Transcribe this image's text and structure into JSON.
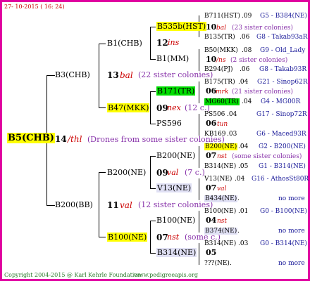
{
  "header": {
    "date": "27- 10-2015 ( 16: 24)"
  },
  "footer": {
    "copyright": "Copyright 2004-2015 @ Karl Kehrle Foundation.",
    "site": "www.pedigreeapis.org"
  },
  "root": {
    "name": "B5(CHB)",
    "num": "14",
    "ins": "/thl",
    "note": "(Drones from some sister colonies)"
  },
  "gen1": {
    "upper": {
      "name": "B3(CHB)",
      "num": "13",
      "ins": "bal",
      "note": "(22 sister colonies)"
    },
    "lower": {
      "name": "B200(BB)",
      "num": "11",
      "ins": "val",
      "note": "(12 sister colonies)"
    }
  },
  "gen2": {
    "b1chb": {
      "name": "B1(CHB)"
    },
    "b47": {
      "name": "B47(MKK)",
      "num": "09",
      "ins": "nex",
      "note": "(12 c.)"
    },
    "b200ne": {
      "name": "B200(NE)",
      "num": "09",
      "ins": "val",
      "note": "(7 c.)"
    },
    "b100ne": {
      "name": "B100(NE)",
      "num": "07",
      "ins": "nst",
      "note": "(some c.)"
    }
  },
  "gen3": {
    "b535b": {
      "name": "B535b(HST)",
      "num": "12",
      "ins": "ins"
    },
    "b1mm": {
      "name": "B1(MM)"
    },
    "b171": {
      "name": "B171(TR)",
      "num": "06",
      "ins": "mrk",
      "note": "(21 sister colonies)"
    },
    "ps596": {
      "name": "PS596",
      "num": "06",
      "ins": "tun"
    },
    "b200ne2": {
      "name": "B200(NE)",
      "num": "07",
      "ins": "nst",
      "note": "(some sister colonies)"
    },
    "v13": {
      "name": "V13(NE)",
      "num": "07",
      "ins": "val"
    },
    "b100ne2": {
      "name": "B100(NE)",
      "num": "04",
      "ins": "nst"
    },
    "b314": {
      "name": "B314(NE)",
      "num": "05"
    }
  },
  "gen4": [
    {
      "name": "B711(HST)",
      "year": ".09",
      "code": "G5 - B384(NE)"
    },
    {
      "num": "10",
      "ins": "bal",
      "note": "(23 sister colonies)"
    },
    {
      "name": "B135(TR)",
      "year": ".06",
      "code": "G8 - Takab93aR"
    },
    {
      "name": "B50(MKK)",
      "year": ".08",
      "code": "G9 - Old_Lady"
    },
    {
      "num": "10",
      "ins": "/ns",
      "note": "(2 sister colonies)"
    },
    {
      "name": "B294(PJ)",
      "year": ".06",
      "code": "G8 - Takab93R"
    },
    {
      "name": "B175(TR)",
      "year": ".04",
      "code": "G21 - Sinop62R"
    },
    {
      "name": "MG60(TR)",
      "year": ".04",
      "code": "G4 - MG00R"
    },
    {
      "name": "PS506",
      "year": ".04",
      "code": "G17 - Sinop72R"
    },
    {
      "name": "KB169",
      "year": ".03",
      "code": "G6 - Maced93R"
    },
    {
      "name": "B200(NE)",
      "year": ".04",
      "code": "G2 - B200(NE)"
    },
    {
      "name": "B314(NE)",
      "year": ".05",
      "code": "G1 - B314(NE)"
    },
    {
      "name": "V13(NE)",
      "year": ".04",
      "code": "G16 - AthosSt80R"
    },
    {
      "name": "B434(NE)",
      "year": ".",
      "code": "no more"
    },
    {
      "name": "B100(NE)",
      "year": ".01",
      "code": "G0 - B100(NE)"
    },
    {
      "name": "B374(NE)",
      "year": ".",
      "code": "no more"
    },
    {
      "name": "B314(NE)",
      "year": ".03",
      "code": "G0 - B314(NE)"
    },
    {
      "name": "???(NE)",
      "year": ".",
      "code": "no more"
    }
  ]
}
